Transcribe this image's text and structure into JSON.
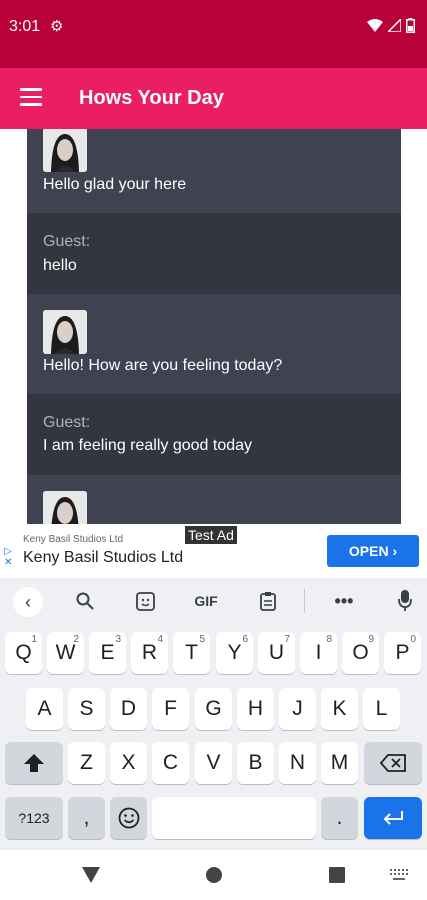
{
  "status_bar": {
    "time": "3:01"
  },
  "app_bar": {
    "title": "Hows Your Day"
  },
  "chat": {
    "messages": [
      {
        "sender": "bot",
        "text": "Hello glad your here"
      },
      {
        "sender": "guest",
        "label": "Guest:",
        "text": "hello"
      },
      {
        "sender": "bot",
        "text": "Hello! How are you feeling today?"
      },
      {
        "sender": "guest",
        "label": "Guest:",
        "text": "I am feeling really good today"
      },
      {
        "sender": "bot",
        "text": ""
      }
    ]
  },
  "ad": {
    "badge": "Test Ad",
    "advertiser_small": "Keny Basil Studios Ltd",
    "advertiser": "Keny Basil Studios Ltd",
    "button": "OPEN"
  },
  "keyboard": {
    "row1": [
      {
        "key": "Q",
        "hint": "1"
      },
      {
        "key": "W",
        "hint": "2"
      },
      {
        "key": "E",
        "hint": "3"
      },
      {
        "key": "R",
        "hint": "4"
      },
      {
        "key": "T",
        "hint": "5"
      },
      {
        "key": "Y",
        "hint": "6"
      },
      {
        "key": "U",
        "hint": "7"
      },
      {
        "key": "I",
        "hint": "8"
      },
      {
        "key": "O",
        "hint": "9"
      },
      {
        "key": "P",
        "hint": "0"
      }
    ],
    "row2": [
      "A",
      "S",
      "D",
      "F",
      "G",
      "H",
      "J",
      "K",
      "L"
    ],
    "row3": [
      "Z",
      "X",
      "C",
      "V",
      "B",
      "N",
      "M"
    ],
    "symbols": "?123",
    "comma": ",",
    "period": ".",
    "gif": "GIF"
  }
}
